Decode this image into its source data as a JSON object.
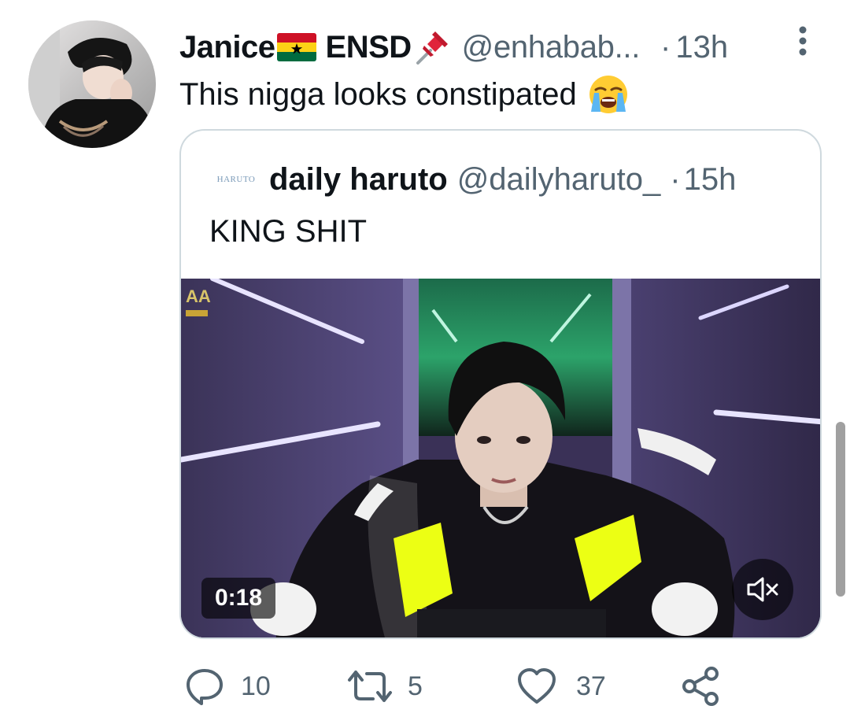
{
  "tweet": {
    "author": {
      "display_name_part1": "Janice",
      "display_name_part2": "ENSD",
      "flag_icon": "ghana-flag-icon",
      "pin_icon": "pushpin-icon",
      "handle": "@enhabab...",
      "separator": "·",
      "time": "13h"
    },
    "text": "This nigga looks constipated",
    "emoji_icon": "loudly-crying-face-icon"
  },
  "quote": {
    "avatar_text": "HARUTO",
    "display_name": "daily haruto",
    "handle": "@dailyharuto_",
    "separator": "·",
    "time": "15h",
    "text": "KING SHIT",
    "video": {
      "duration": "0:18",
      "muted": true
    }
  },
  "actions": {
    "replies": "10",
    "retweets": "5",
    "likes": "37"
  },
  "colors": {
    "text_primary": "#0f1419",
    "text_secondary": "#536471",
    "border": "#cfd9de"
  }
}
